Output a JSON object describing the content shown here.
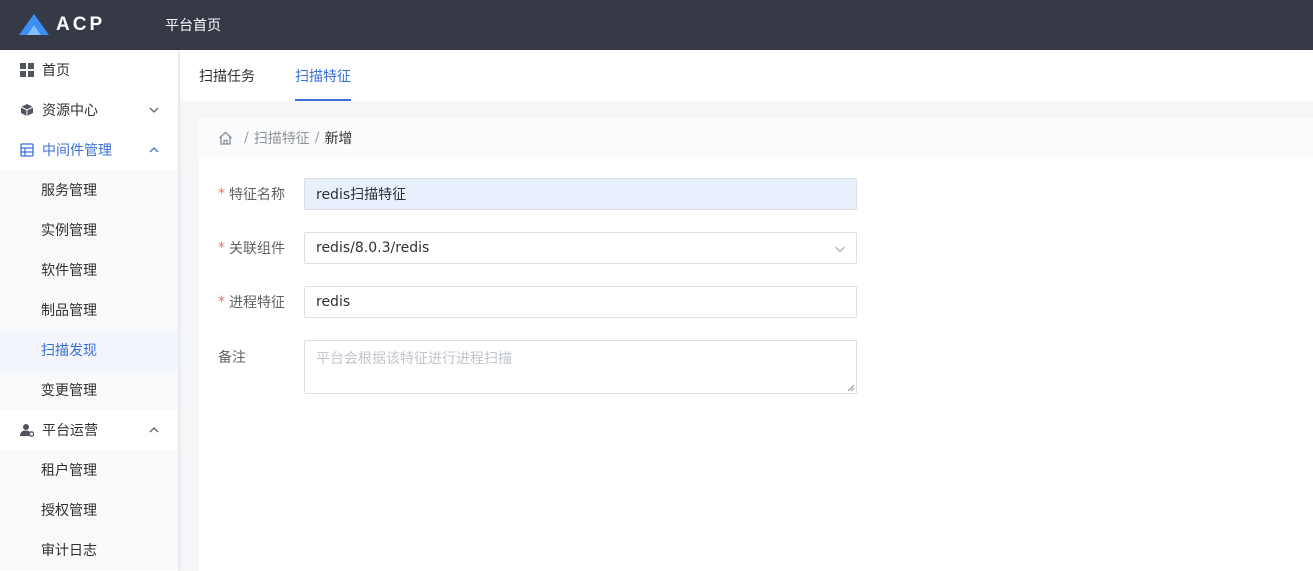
{
  "header": {
    "logo_text": "ACP",
    "nav_home": "平台首页"
  },
  "sidebar": {
    "items": [
      {
        "label": "首页",
        "icon": "grid-icon"
      },
      {
        "label": "资源中心",
        "icon": "cube-icon",
        "expanded": false
      },
      {
        "label": "中间件管理",
        "icon": "middleware-icon",
        "expanded": true,
        "active": true
      },
      {
        "label": "平台运营",
        "icon": "user-gear-icon",
        "expanded": true
      }
    ],
    "middleware_sub": [
      "服务管理",
      "实例管理",
      "软件管理",
      "制品管理",
      "扫描发现",
      "变更管理"
    ],
    "ops_sub": [
      "租户管理",
      "授权管理",
      "审计日志"
    ],
    "active_sub": "扫描发现"
  },
  "tabs": [
    {
      "label": "扫描任务",
      "active": false
    },
    {
      "label": "扫描特征",
      "active": true
    }
  ],
  "breadcrumb": {
    "sep": "/",
    "parent": "扫描特征",
    "current": "新增"
  },
  "form": {
    "name_label": "特征名称",
    "name_value": "redis扫描特征",
    "component_label": "关联组件",
    "component_value": "redis/8.0.3/redis",
    "process_label": "进程特征",
    "process_value": "redis",
    "remark_label": "备注",
    "remark_placeholder": "平台会根据该特征进行进程扫描",
    "required_mark": "*"
  },
  "colors": {
    "accent": "#3a6fd8",
    "topbar": "#363a47",
    "required": "#f56c6c"
  }
}
